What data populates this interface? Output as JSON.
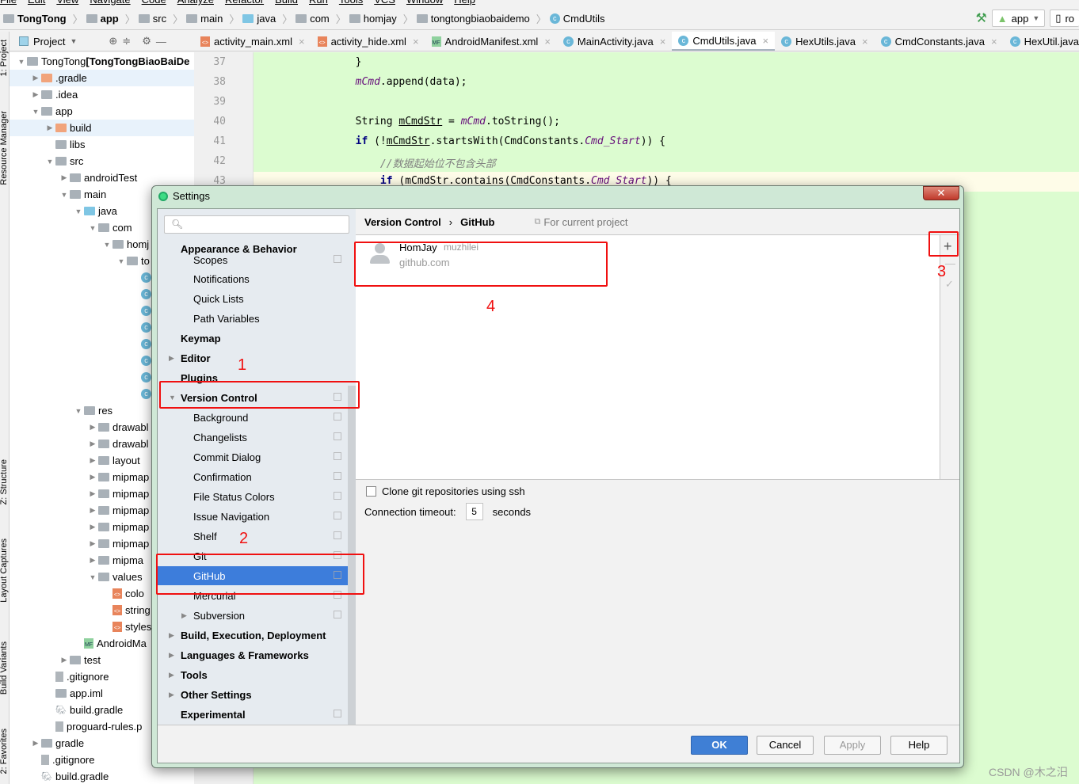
{
  "menu": [
    "File",
    "Edit",
    "View",
    "Navigate",
    "Code",
    "Analyze",
    "Refactor",
    "Build",
    "Run",
    "Tools",
    "VCS",
    "Window",
    "Help"
  ],
  "breadcrumb": [
    "TongTong",
    "app",
    "src",
    "main",
    "java",
    "com",
    "homjay",
    "tongtongbiaobaidemo",
    "CmdUtils"
  ],
  "toolbar": {
    "run_config": "app",
    "device": "ro"
  },
  "side_strip": [
    "1: Project",
    "Resource Manager",
    "Z: Structure",
    "Layout Captures",
    "Build Variants",
    "2: Favorites"
  ],
  "project_panel": {
    "title": "Project"
  },
  "tabs": [
    {
      "label": "activity_main.xml",
      "icon": "xml"
    },
    {
      "label": "activity_hide.xml",
      "icon": "xml"
    },
    {
      "label": "AndroidManifest.xml",
      "icon": "mf"
    },
    {
      "label": "MainActivity.java",
      "icon": "class"
    },
    {
      "label": "CmdUtils.java",
      "icon": "class",
      "active": true
    },
    {
      "label": "HexUtils.java",
      "icon": "class"
    },
    {
      "label": "CmdConstants.java",
      "icon": "class"
    },
    {
      "label": "HexUtil.java",
      "icon": "class"
    }
  ],
  "tree": [
    {
      "label": "TongTong ",
      "bold": "[TongTongBiaoBaiDe",
      "indent": 0,
      "arrow": "down",
      "icon": "module"
    },
    {
      "label": ".gradle",
      "indent": 1,
      "arrow": "right",
      "icon": "orange",
      "hl": true
    },
    {
      "label": ".idea",
      "indent": 1,
      "arrow": "right",
      "icon": "folder"
    },
    {
      "label": "app",
      "indent": 1,
      "arrow": "down",
      "icon": "folder"
    },
    {
      "label": "build",
      "indent": 2,
      "arrow": "right",
      "icon": "orange",
      "hl": true
    },
    {
      "label": "libs",
      "indent": 2,
      "arrow": "",
      "icon": "folder"
    },
    {
      "label": "src",
      "indent": 2,
      "arrow": "down",
      "icon": "folder"
    },
    {
      "label": "androidTest",
      "indent": 3,
      "arrow": "right",
      "icon": "folder"
    },
    {
      "label": "main",
      "indent": 3,
      "arrow": "down",
      "icon": "folder"
    },
    {
      "label": "java",
      "indent": 4,
      "arrow": "down",
      "icon": "blue"
    },
    {
      "label": "com",
      "indent": 5,
      "arrow": "down",
      "icon": "folder"
    },
    {
      "label": "homj",
      "indent": 6,
      "arrow": "down",
      "icon": "folder"
    },
    {
      "label": "to",
      "indent": 7,
      "arrow": "down",
      "icon": "folder"
    },
    {
      "label": "",
      "indent": 8,
      "icon": "class"
    },
    {
      "label": "",
      "indent": 8,
      "icon": "class"
    },
    {
      "label": "",
      "indent": 8,
      "icon": "class"
    },
    {
      "label": "",
      "indent": 8,
      "icon": "class"
    },
    {
      "label": "",
      "indent": 8,
      "icon": "class"
    },
    {
      "label": "",
      "indent": 8,
      "icon": "class"
    },
    {
      "label": "",
      "indent": 8,
      "icon": "class"
    },
    {
      "label": "",
      "indent": 8,
      "icon": "class"
    },
    {
      "label": "res",
      "indent": 4,
      "arrow": "down",
      "icon": "folder"
    },
    {
      "label": "drawabl",
      "indent": 5,
      "arrow": "right",
      "icon": "folder"
    },
    {
      "label": "drawabl",
      "indent": 5,
      "arrow": "right",
      "icon": "folder"
    },
    {
      "label": "layout",
      "indent": 5,
      "arrow": "right",
      "icon": "folder"
    },
    {
      "label": "mipmap",
      "indent": 5,
      "arrow": "right",
      "icon": "folder"
    },
    {
      "label": "mipmap",
      "indent": 5,
      "arrow": "right",
      "icon": "folder"
    },
    {
      "label": "mipmap",
      "indent": 5,
      "arrow": "right",
      "icon": "folder"
    },
    {
      "label": "mipmap",
      "indent": 5,
      "arrow": "right",
      "icon": "folder"
    },
    {
      "label": "mipmap",
      "indent": 5,
      "arrow": "right",
      "icon": "folder"
    },
    {
      "label": "mipma",
      "indent": 5,
      "arrow": "right",
      "icon": "folder"
    },
    {
      "label": "values",
      "indent": 5,
      "arrow": "down",
      "icon": "folder"
    },
    {
      "label": "colo",
      "indent": 6,
      "arrow": "",
      "icon": "xml"
    },
    {
      "label": "string",
      "indent": 6,
      "arrow": "",
      "icon": "xml"
    },
    {
      "label": "styles",
      "indent": 6,
      "arrow": "",
      "icon": "xml"
    },
    {
      "label": "AndroidMa",
      "indent": 4,
      "arrow": "",
      "icon": "mf"
    },
    {
      "label": "test",
      "indent": 3,
      "arrow": "right",
      "icon": "folder"
    },
    {
      "label": ".gitignore",
      "indent": 2,
      "arrow": "",
      "icon": "file"
    },
    {
      "label": "app.iml",
      "indent": 2,
      "arrow": "",
      "icon": "folder"
    },
    {
      "label": "build.gradle",
      "indent": 2,
      "arrow": "",
      "icon": "gradle"
    },
    {
      "label": "proguard-rules.p",
      "indent": 2,
      "arrow": "",
      "icon": "file"
    },
    {
      "label": "gradle",
      "indent": 1,
      "arrow": "right",
      "icon": "folder"
    },
    {
      "label": ".gitignore",
      "indent": 1,
      "arrow": "",
      "icon": "file"
    },
    {
      "label": "build.gradle",
      "indent": 1,
      "arrow": "",
      "icon": "gradle"
    }
  ],
  "editor": {
    "line_numbers": [
      "37",
      "38",
      "39",
      "40",
      "41",
      "42",
      "43"
    ],
    "lines": [
      [
        [
          "",
          "        }"
        ]
      ],
      [
        [
          "fld",
          "        mCmd"
        ],
        [
          "",
          ".append(data);"
        ]
      ],
      [
        [
          "",
          ""
        ]
      ],
      [
        [
          "",
          "        String "
        ],
        [
          "ul",
          "mCmdStr"
        ],
        [
          "",
          " = "
        ],
        [
          "fld",
          "mCmd"
        ],
        [
          "",
          ".toString();"
        ]
      ],
      [
        [
          "kw",
          "        if"
        ],
        [
          "",
          " (!"
        ],
        [
          "ul",
          "mCmdStr"
        ],
        [
          "",
          ".startsWith(CmdConstants."
        ],
        [
          "fld",
          "Cmd_Start"
        ],
        [
          "",
          "))"
        ],
        [
          "",
          " {"
        ]
      ],
      [
        [
          "cm",
          "            //数据起始位不包含头部"
        ]
      ],
      [
        [
          "kw",
          "            if"
        ],
        [
          "",
          " (mCmdStr.contains(CmdConstants."
        ],
        [
          "fld",
          "Cmd_Start"
        ],
        [
          "",
          ")) {"
        ]
      ]
    ]
  },
  "dialog": {
    "title": "Settings",
    "search_placeholder": "",
    "sidebar": [
      {
        "label": "Appearance & Behavior",
        "level": 0,
        "bold": true
      },
      {
        "label": "Scopes",
        "level": 1,
        "copy": true
      },
      {
        "label": "Notifications",
        "level": 1
      },
      {
        "label": "Quick Lists",
        "level": 1
      },
      {
        "label": "Path Variables",
        "level": 1
      },
      {
        "label": "Keymap",
        "level": 0,
        "bold": true
      },
      {
        "label": "Editor",
        "level": 0,
        "bold": true,
        "arrow": "right"
      },
      {
        "label": "Plugins",
        "level": 0,
        "bold": true
      },
      {
        "label": "Version Control",
        "level": 0,
        "bold": true,
        "arrow": "down",
        "copy": true
      },
      {
        "label": "Background",
        "level": 1,
        "copy": true
      },
      {
        "label": "Changelists",
        "level": 1,
        "copy": true
      },
      {
        "label": "Commit Dialog",
        "level": 1,
        "copy": true
      },
      {
        "label": "Confirmation",
        "level": 1,
        "copy": true
      },
      {
        "label": "File Status Colors",
        "level": 1,
        "copy": true
      },
      {
        "label": "Issue Navigation",
        "level": 1,
        "copy": true
      },
      {
        "label": "Shelf",
        "level": 1,
        "copy": true
      },
      {
        "label": "Git",
        "level": 1,
        "copy": true
      },
      {
        "label": "GitHub",
        "level": 1,
        "copy": true,
        "selected": true
      },
      {
        "label": "Mercurial",
        "level": 1,
        "copy": true
      },
      {
        "label": "Subversion",
        "level": 1,
        "arrow": "right",
        "copy": true
      },
      {
        "label": "Build, Execution, Deployment",
        "level": 0,
        "bold": true,
        "arrow": "right"
      },
      {
        "label": "Languages & Frameworks",
        "level": 0,
        "bold": true,
        "arrow": "right"
      },
      {
        "label": "Tools",
        "level": 0,
        "bold": true,
        "arrow": "right"
      },
      {
        "label": "Other Settings",
        "level": 0,
        "bold": true,
        "arrow": "right"
      },
      {
        "label": "Experimental",
        "level": 0,
        "bold": true,
        "copy": true
      }
    ],
    "header": {
      "parent": "Version Control",
      "sep": "›",
      "current": "GitHub",
      "scope": "For current project"
    },
    "account": {
      "name": "HomJay",
      "login": "muzhilei",
      "server": "github.com"
    },
    "clone_ssh": {
      "label": "Clone git repositories using ssh",
      "checked": false
    },
    "timeout": {
      "label": "Connection timeout:",
      "value": "5",
      "unit": "seconds"
    },
    "buttons": {
      "ok": "OK",
      "cancel": "Cancel",
      "apply": "Apply",
      "help": "Help"
    }
  },
  "annotations": [
    "1",
    "2",
    "3",
    "4"
  ],
  "annotation_color": "#f01010",
  "watermark": "CSDN @木之汨"
}
